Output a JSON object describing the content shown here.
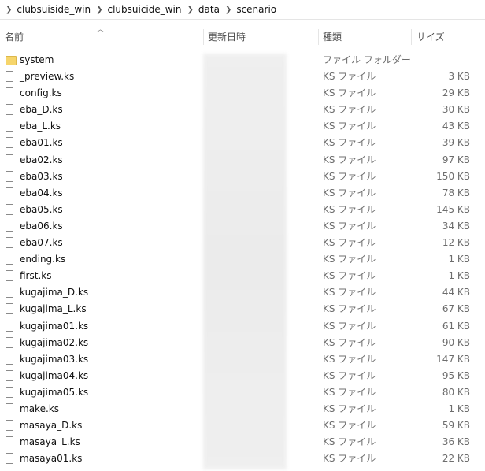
{
  "breadcrumb": {
    "items": [
      "clubsuiside_win",
      "clubsuicide_win",
      "data",
      "scenario"
    ]
  },
  "columns": {
    "name": "名前",
    "date": "更新日時",
    "type": "種類",
    "size": "サイズ"
  },
  "files": [
    {
      "name": "system",
      "type": "ファイル フォルダー",
      "size": "",
      "icon": "folder-icon"
    },
    {
      "name": "_preview.ks",
      "type": "KS ファイル",
      "size": "3 KB",
      "icon": "file-icon"
    },
    {
      "name": "config.ks",
      "type": "KS ファイル",
      "size": "29 KB",
      "icon": "file-icon"
    },
    {
      "name": "eba_D.ks",
      "type": "KS ファイル",
      "size": "30 KB",
      "icon": "file-icon"
    },
    {
      "name": "eba_L.ks",
      "type": "KS ファイル",
      "size": "43 KB",
      "icon": "file-icon"
    },
    {
      "name": "eba01.ks",
      "type": "KS ファイル",
      "size": "39 KB",
      "icon": "file-icon"
    },
    {
      "name": "eba02.ks",
      "type": "KS ファイル",
      "size": "97 KB",
      "icon": "file-icon"
    },
    {
      "name": "eba03.ks",
      "type": "KS ファイル",
      "size": "150 KB",
      "icon": "file-icon"
    },
    {
      "name": "eba04.ks",
      "type": "KS ファイル",
      "size": "78 KB",
      "icon": "file-icon"
    },
    {
      "name": "eba05.ks",
      "type": "KS ファイル",
      "size": "145 KB",
      "icon": "file-icon"
    },
    {
      "name": "eba06.ks",
      "type": "KS ファイル",
      "size": "34 KB",
      "icon": "file-icon"
    },
    {
      "name": "eba07.ks",
      "type": "KS ファイル",
      "size": "12 KB",
      "icon": "file-icon"
    },
    {
      "name": "ending.ks",
      "type": "KS ファイル",
      "size": "1 KB",
      "icon": "file-icon"
    },
    {
      "name": "first.ks",
      "type": "KS ファイル",
      "size": "1 KB",
      "icon": "file-icon"
    },
    {
      "name": "kugajima_D.ks",
      "type": "KS ファイル",
      "size": "44 KB",
      "icon": "file-icon"
    },
    {
      "name": "kugajima_L.ks",
      "type": "KS ファイル",
      "size": "67 KB",
      "icon": "file-icon"
    },
    {
      "name": "kugajima01.ks",
      "type": "KS ファイル",
      "size": "61 KB",
      "icon": "file-icon"
    },
    {
      "name": "kugajima02.ks",
      "type": "KS ファイル",
      "size": "90 KB",
      "icon": "file-icon"
    },
    {
      "name": "kugajima03.ks",
      "type": "KS ファイル",
      "size": "147 KB",
      "icon": "file-icon"
    },
    {
      "name": "kugajima04.ks",
      "type": "KS ファイル",
      "size": "95 KB",
      "icon": "file-icon"
    },
    {
      "name": "kugajima05.ks",
      "type": "KS ファイル",
      "size": "80 KB",
      "icon": "file-icon"
    },
    {
      "name": "make.ks",
      "type": "KS ファイル",
      "size": "1 KB",
      "icon": "file-icon"
    },
    {
      "name": "masaya_D.ks",
      "type": "KS ファイル",
      "size": "59 KB",
      "icon": "file-icon"
    },
    {
      "name": "masaya_L.ks",
      "type": "KS ファイル",
      "size": "36 KB",
      "icon": "file-icon"
    },
    {
      "name": "masaya01.ks",
      "type": "KS ファイル",
      "size": "22 KB",
      "icon": "file-icon"
    }
  ]
}
